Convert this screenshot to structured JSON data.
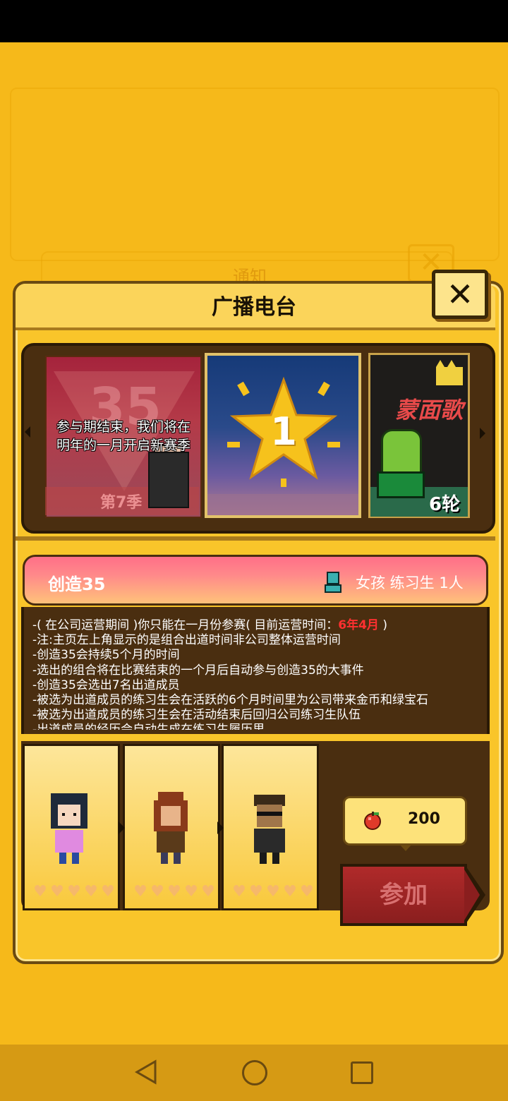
{
  "dialog": {
    "title": "广播电台",
    "close_label": "✕"
  },
  "background": {
    "faint_title": "通知"
  },
  "carousel": {
    "cards": [
      {
        "overlay_line1": "参与期结束，我们将在",
        "overlay_line2": "明年的一月开启新赛季",
        "background_number": "35",
        "season_label": "第7季"
      },
      {
        "star_number": "1"
      },
      {
        "title": "蒙面歌",
        "badge": "6轮"
      }
    ]
  },
  "event": {
    "name": "创造35",
    "requirement": "女孩 练习生 1人"
  },
  "description": {
    "line1_prefix": "-( 在公司运营期间 )你只能在一月份参赛( 目前运营时间：",
    "line1_highlight": "6年4月",
    "line1_suffix": " )",
    "lines": [
      "-注:主页左上角显示的是组合出道时间非公司整体运营时间",
      "-创造35会持续5个月的时间",
      "-选出的组合将在比赛结束的一个月后自动参与创造35的大事件",
      "-创造35会选出7名出道成员",
      "-被选为出道成员的练习生会在活跃的6个月时间里为公司带来金币和绿宝石",
      "-被选为出道成员的练习生会在活动结束后回归公司练习生队伍",
      "-出道成员的经历会自动生成在练习生履历里"
    ]
  },
  "trainees": [
    {
      "name": "trainee-1",
      "hearts": 5
    },
    {
      "name": "trainee-2",
      "hearts": 5
    },
    {
      "name": "trainee-3",
      "hearts": 5
    }
  ],
  "cost": {
    "icon": "apple-icon",
    "value": "200"
  },
  "join_button": {
    "label": "参加"
  },
  "colors": {
    "background": "#f6b91a",
    "panel_dark": "#4a2e10",
    "highlight_red": "#ff3030",
    "join_red": "#8a1e1e"
  }
}
